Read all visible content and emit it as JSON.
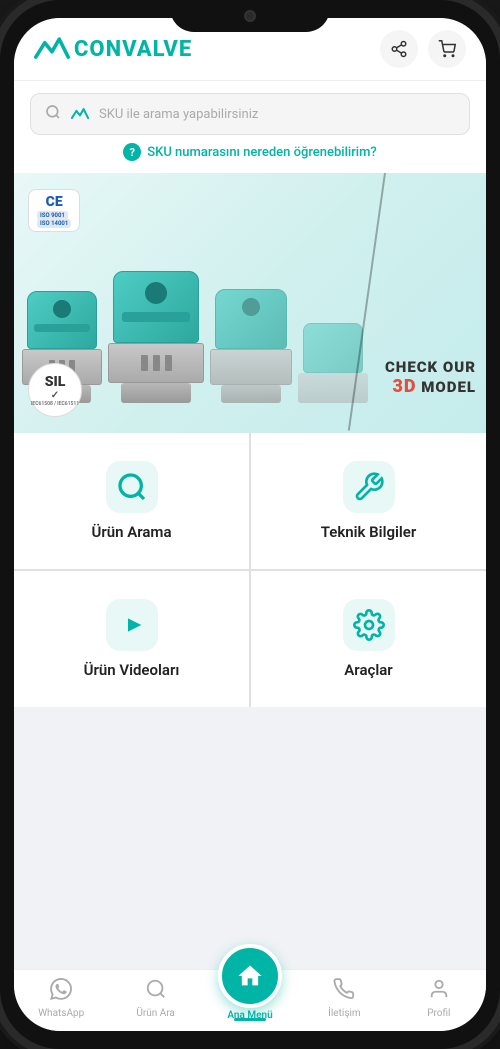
{
  "phone": {
    "notch": true
  },
  "header": {
    "logo_text": "CONVALVE",
    "share_icon": "share",
    "cart_icon": "cart"
  },
  "search": {
    "placeholder": "SKU ile arama yapabilirsiniz",
    "sku_hint": "SKU numarasını nereden öğrenebilirim?"
  },
  "banner": {
    "check_text": "CHECK OUR",
    "model_text": "MODEL",
    "number_3d": "3D",
    "badge_ce": "CE",
    "badge_sil": "SIL",
    "badge_sil_sub": "SIL✓"
  },
  "grid": {
    "items": [
      {
        "id": "product-search",
        "label": "Ürün Arama",
        "icon": "search"
      },
      {
        "id": "technical-info",
        "label": "Teknik Bilgiler",
        "icon": "wrench"
      },
      {
        "id": "product-videos",
        "label": "Ürün Videoları",
        "icon": "play"
      },
      {
        "id": "tools",
        "label": "Araçlar",
        "icon": "gear"
      }
    ]
  },
  "bottom_nav": {
    "items": [
      {
        "id": "whatsapp",
        "label": "WhatsApp",
        "icon": "whatsapp"
      },
      {
        "id": "product-search",
        "label": "Ürün Ara",
        "icon": "search"
      },
      {
        "id": "home",
        "label": "Ana Menü",
        "icon": "home",
        "active": true,
        "center": true
      },
      {
        "id": "contact",
        "label": "İletişim",
        "icon": "phone"
      },
      {
        "id": "profile",
        "label": "Profil",
        "icon": "user"
      }
    ]
  }
}
